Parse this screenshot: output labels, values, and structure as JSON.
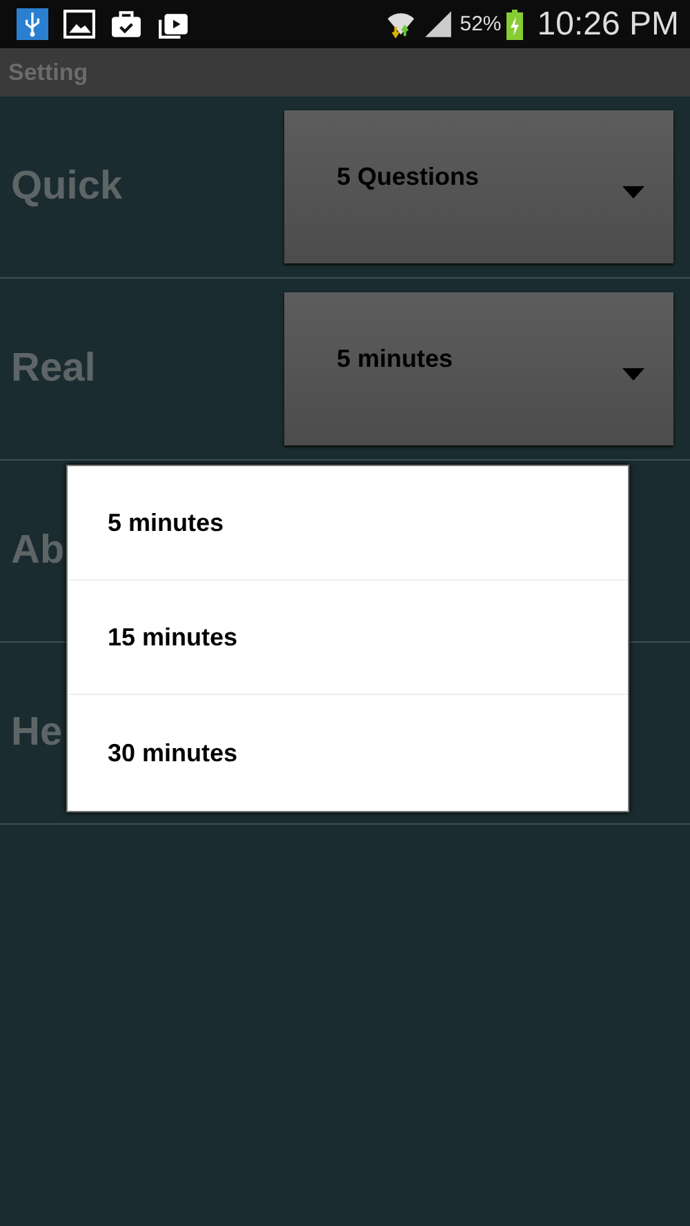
{
  "status_bar": {
    "battery": "52%",
    "time": "10:26 PM"
  },
  "title": "Setting",
  "settings": [
    {
      "label": "Quick",
      "kind": "spinner",
      "value": "5 Questions"
    },
    {
      "label": "Real",
      "kind": "spinner",
      "value": "5 minutes"
    },
    {
      "label": "Ab",
      "kind": "plain"
    },
    {
      "label": "He",
      "kind": "plain"
    }
  ],
  "popup": {
    "options": [
      "5 minutes",
      "15 minutes",
      "30 minutes"
    ]
  }
}
